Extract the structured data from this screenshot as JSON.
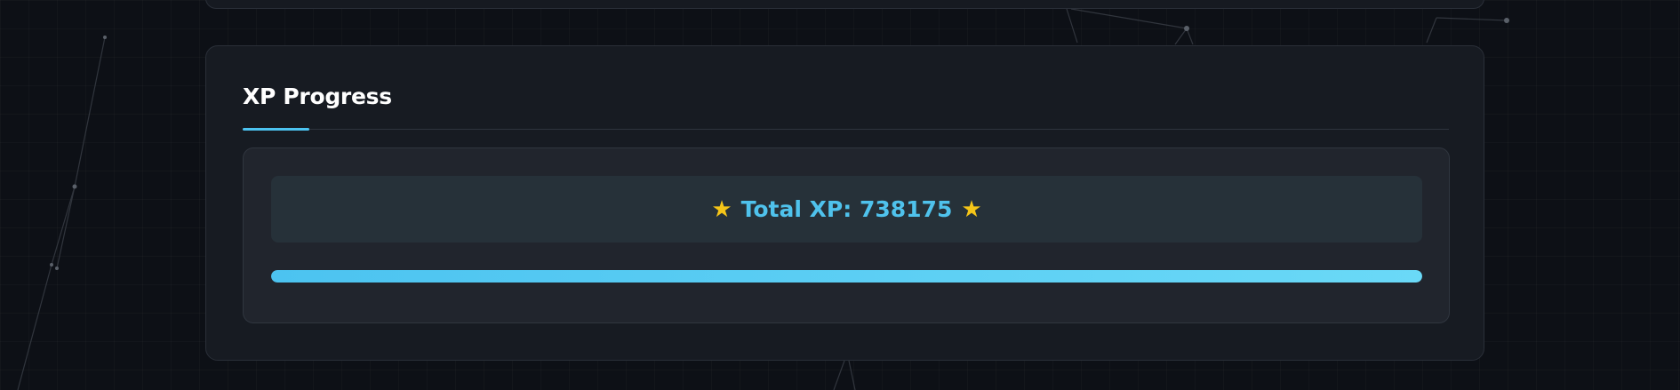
{
  "xp_card": {
    "title": "XP Progress",
    "star_icon": "star-icon",
    "total_label": "Total XP:",
    "total_value": "738175",
    "progress_fraction": 1.0
  },
  "colors": {
    "accent": "#4cc3f0",
    "star": "#f5c518",
    "card_bg": "#171b22",
    "panel_bg": "#21252d"
  }
}
